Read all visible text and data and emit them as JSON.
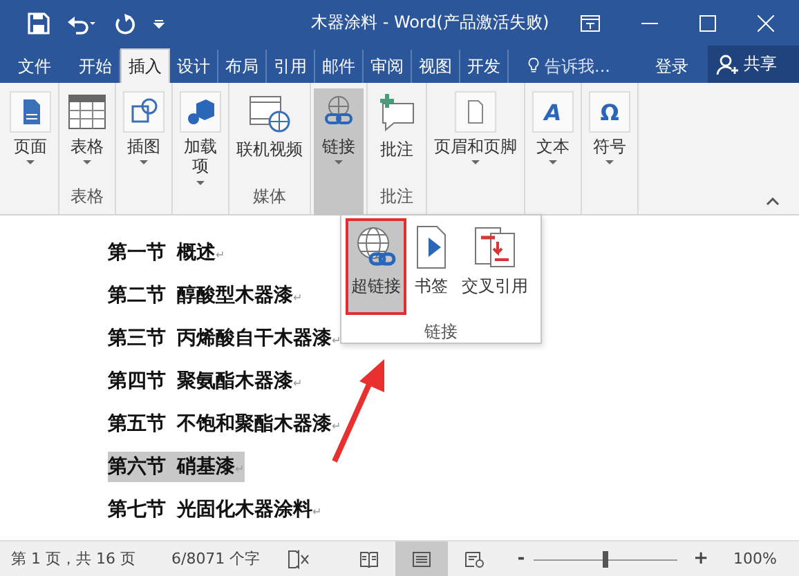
{
  "window": {
    "title": "木器涂料 - Word(产品激活失败)"
  },
  "tabs": [
    {
      "label": "文件",
      "selected": false
    },
    {
      "label": "开始",
      "selected": false
    },
    {
      "label": "插入",
      "selected": true
    },
    {
      "label": "设计",
      "selected": false
    },
    {
      "label": "布局",
      "selected": false
    },
    {
      "label": "引用",
      "selected": false
    },
    {
      "label": "邮件",
      "selected": false
    },
    {
      "label": "审阅",
      "selected": false
    },
    {
      "label": "视图",
      "selected": false
    },
    {
      "label": "开发",
      "selected": false
    }
  ],
  "tell_me": {
    "placeholder": "告诉我..."
  },
  "sign_in": "登录",
  "share": "共享",
  "ribbon": {
    "groups": [
      {
        "buttons": [
          {
            "label": "页面",
            "dropdown": true,
            "selected": false
          }
        ]
      },
      {
        "label": "表格",
        "buttons": [
          {
            "label": "表格",
            "dropdown": true,
            "selected": false
          }
        ]
      },
      {
        "buttons": [
          {
            "label": "插图",
            "dropdown": true,
            "selected": false
          }
        ]
      },
      {
        "buttons": [
          {
            "label": "加载项",
            "dropdown": true,
            "selected": false
          }
        ]
      },
      {
        "label": "媒体",
        "buttons": [
          {
            "label": "联机视频",
            "dropdown": false,
            "selected": false
          }
        ]
      },
      {
        "buttons": [
          {
            "label": "链接",
            "dropdown": true,
            "selected": true
          }
        ]
      },
      {
        "label": "批注",
        "buttons": [
          {
            "label": "批注",
            "dropdown": false,
            "selected": false
          }
        ]
      },
      {
        "buttons": [
          {
            "label": "页眉和页脚",
            "dropdown": true,
            "selected": false
          }
        ]
      },
      {
        "buttons": [
          {
            "label": "文本",
            "dropdown": true,
            "selected": false,
            "icon_text": "A"
          }
        ]
      },
      {
        "buttons": [
          {
            "label": "符号",
            "dropdown": true,
            "selected": false,
            "icon_text": "Ω"
          }
        ]
      }
    ]
  },
  "document": {
    "lines": [
      {
        "section": "第一节",
        "title": "概述",
        "mark": "↵",
        "selected": false
      },
      {
        "section": "第二节",
        "title": "醇酸型木器漆",
        "mark": "↵",
        "selected": false
      },
      {
        "section": "第三节",
        "title": "丙烯酸自干木器漆",
        "mark": "↵",
        "selected": false
      },
      {
        "section": "第四节",
        "title": "聚氨酯木器漆",
        "mark": "↵",
        "selected": false
      },
      {
        "section": "第五节",
        "title": "不饱和聚酯木器漆",
        "mark": "↵",
        "selected": false
      },
      {
        "section": "第六节",
        "title": "硝基漆",
        "mark": "↵",
        "selected": true
      },
      {
        "section": "第七节",
        "title": "光固化木器涂料",
        "mark": "↵",
        "selected": false
      }
    ]
  },
  "links_menu": {
    "items": [
      {
        "label": "超链接",
        "selected": true
      },
      {
        "label": "书签",
        "selected": false
      },
      {
        "label": "交叉引用",
        "selected": false
      }
    ],
    "label": "链接"
  },
  "status_bar": {
    "page": "第 1 页，共 16 页",
    "words": "6/8071 个字",
    "views": [
      {
        "selected": false
      },
      {
        "selected": true
      },
      {
        "selected": false
      }
    ],
    "zoom_out": "-",
    "zoom_slider": {
      "level": 0.5
    },
    "zoom_in": "+",
    "zoom": "100%"
  }
}
